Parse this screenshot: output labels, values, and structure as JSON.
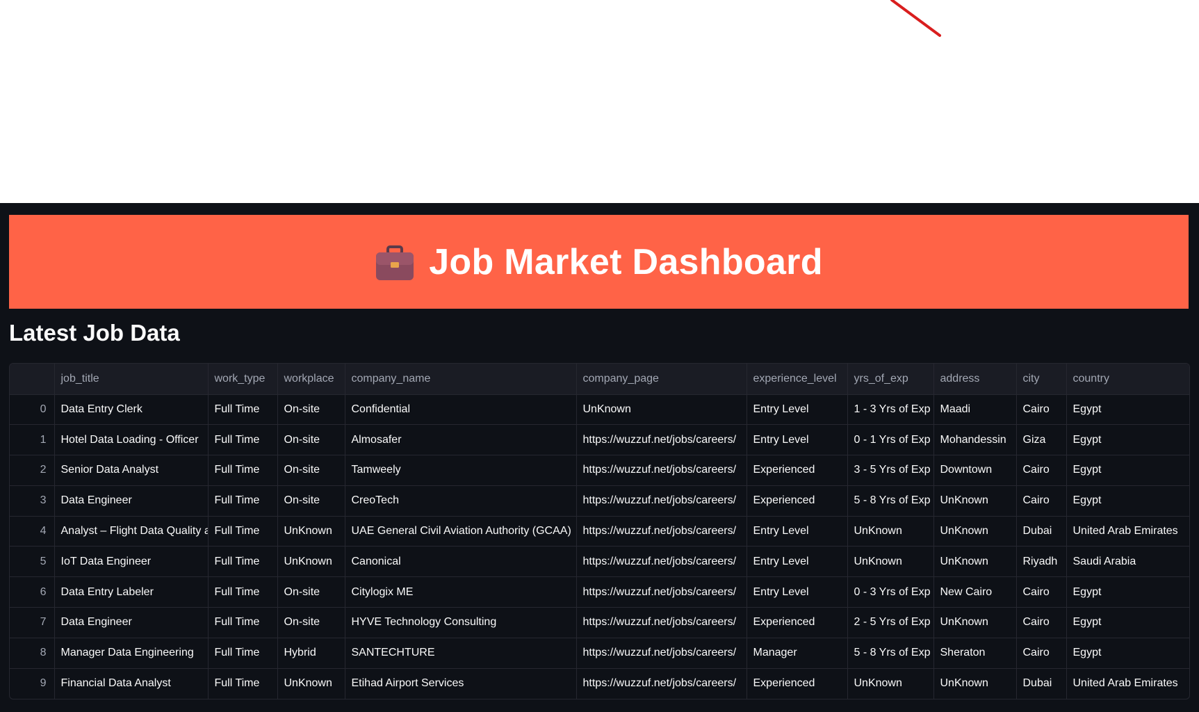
{
  "header": {
    "title": "Job Market Dashboard",
    "icon": "briefcase-icon",
    "banner_color": "#ff6347"
  },
  "section": {
    "title": "Latest Job Data"
  },
  "table": {
    "columns": [
      "",
      "job_title",
      "work_type",
      "workplace",
      "company_name",
      "company_page",
      "experience_level",
      "yrs_of_exp",
      "address",
      "city",
      "country"
    ],
    "rows": [
      [
        "0",
        "Data Entry Clerk",
        "Full Time",
        "On-site",
        "Confidential",
        "UnKnown",
        "Entry Level",
        "1 - 3 Yrs of Exp",
        "Maadi",
        "Cairo",
        "Egypt"
      ],
      [
        "1",
        "Hotel Data Loading - Officer",
        "Full Time",
        "On-site",
        "Almosafer",
        "https://wuzzuf.net/jobs/careers/",
        "Entry Level",
        "0 - 1 Yrs of Exp",
        "Mohandessin",
        "Giza",
        "Egypt"
      ],
      [
        "2",
        "Senior Data Analyst",
        "Full Time",
        "On-site",
        "Tamweely",
        "https://wuzzuf.net/jobs/careers/",
        "Experienced",
        "3 - 5 Yrs of Exp",
        "Downtown",
        "Cairo",
        "Egypt"
      ],
      [
        "3",
        "Data Engineer",
        "Full Time",
        "On-site",
        "CreoTech",
        "https://wuzzuf.net/jobs/careers/",
        "Experienced",
        "5 - 8 Yrs of Exp",
        "UnKnown",
        "Cairo",
        "Egypt"
      ],
      [
        "4",
        "Analyst – Flight Data Quality a",
        "Full Time",
        "UnKnown",
        "UAE General Civil Aviation Authority (GCAA)",
        "https://wuzzuf.net/jobs/careers/",
        "Entry Level",
        "UnKnown",
        "UnKnown",
        "Dubai",
        "United Arab Emirates"
      ],
      [
        "5",
        "IoT Data Engineer",
        "Full Time",
        "UnKnown",
        "Canonical",
        "https://wuzzuf.net/jobs/careers/",
        "Entry Level",
        "UnKnown",
        "UnKnown",
        "Riyadh",
        "Saudi Arabia"
      ],
      [
        "6",
        "Data Entry Labeler",
        "Full Time",
        "On-site",
        "Citylogix ME",
        "https://wuzzuf.net/jobs/careers/",
        "Entry Level",
        "0 - 3 Yrs of Exp",
        "New Cairo",
        "Cairo",
        "Egypt"
      ],
      [
        "7",
        "Data Engineer",
        "Full Time",
        "On-site",
        "HYVE Technology Consulting",
        "https://wuzzuf.net/jobs/careers/",
        "Experienced",
        "2 - 5 Yrs of Exp",
        "UnKnown",
        "Cairo",
        "Egypt"
      ],
      [
        "8",
        "Manager Data Engineering",
        "Full Time",
        "Hybrid",
        "SANTECHTURE",
        "https://wuzzuf.net/jobs/careers/",
        "Manager",
        "5 - 8 Yrs of Exp",
        "Sheraton",
        "Cairo",
        "Egypt"
      ],
      [
        "9",
        "Financial Data Analyst",
        "Full Time",
        "UnKnown",
        "Etihad Airport Services",
        "https://wuzzuf.net/jobs/careers/",
        "Experienced",
        "UnKnown",
        "UnKnown",
        "Dubai",
        "United Arab Emirates"
      ]
    ]
  }
}
